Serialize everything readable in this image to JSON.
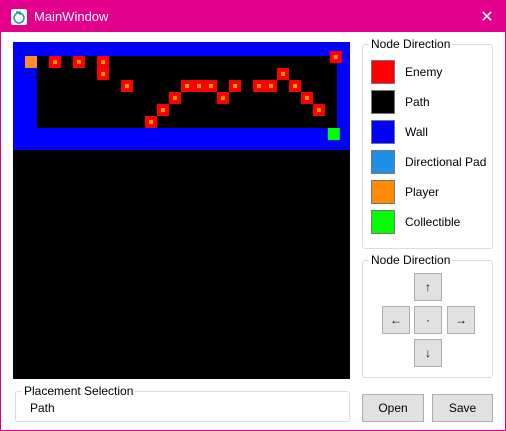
{
  "window": {
    "title": "MainWindow",
    "close_glyph": "✕",
    "accent": "#e3008c"
  },
  "grid": {
    "cols": 14,
    "rows": 14,
    "palette": {
      "wall": "#0000ff",
      "path": "#000000",
      "enemy": "#ff0000",
      "player": "#ff8c28",
      "collectible": "#00ff00",
      "enemy_dot": "#ff9900"
    },
    "cells": {
      "wall": [
        [
          0,
          0
        ],
        [
          1,
          0
        ],
        [
          2,
          0
        ],
        [
          3,
          0
        ],
        [
          4,
          0
        ],
        [
          5,
          0
        ],
        [
          6,
          0
        ],
        [
          7,
          0
        ],
        [
          8,
          0
        ],
        [
          9,
          0
        ],
        [
          10,
          0
        ],
        [
          11,
          0
        ],
        [
          12,
          0
        ],
        [
          13,
          0
        ],
        [
          0,
          1
        ],
        [
          13,
          1
        ],
        [
          0,
          2
        ],
        [
          13,
          2
        ],
        [
          0,
          3
        ],
        [
          13,
          3
        ],
        [
          0,
          4
        ],
        [
          13,
          4
        ],
        [
          0,
          5
        ],
        [
          1,
          5
        ],
        [
          2,
          5
        ],
        [
          3,
          5
        ],
        [
          4,
          5
        ],
        [
          5,
          5
        ],
        [
          6,
          5
        ],
        [
          7,
          5
        ],
        [
          8,
          5
        ],
        [
          9,
          5
        ],
        [
          10,
          5
        ],
        [
          11,
          5
        ],
        [
          12,
          5
        ],
        [
          13,
          5
        ]
      ],
      "player": [
        [
          0,
          0.5
        ]
      ],
      "enemy": [
        [
          1,
          0.5
        ],
        [
          2,
          0.5
        ],
        [
          3,
          0.5
        ],
        [
          3,
          1
        ],
        [
          4,
          1.5
        ],
        [
          5,
          3
        ],
        [
          5.5,
          2.5
        ],
        [
          6,
          2
        ],
        [
          6.5,
          1.5
        ],
        [
          7,
          1.5
        ],
        [
          7.5,
          1.5
        ],
        [
          8,
          2
        ],
        [
          8.5,
          1.5
        ],
        [
          9.5,
          1.5
        ],
        [
          10,
          1.5
        ],
        [
          10.5,
          1
        ],
        [
          11,
          1.5
        ],
        [
          11.5,
          2
        ],
        [
          12,
          2.5
        ],
        [
          12.7,
          0.3
        ]
      ],
      "collectible": [
        [
          12.7,
          3.5
        ]
      ]
    }
  },
  "legend": {
    "title": "Node Direction",
    "items": [
      {
        "label": "Enemy",
        "color": "#ff0000"
      },
      {
        "label": "Path",
        "color": "#000000"
      },
      {
        "label": "Wall",
        "color": "#0000ff"
      },
      {
        "label": "Directional Pad",
        "color": "#1e90e6"
      },
      {
        "label": "Player",
        "color": "#ff8c00"
      },
      {
        "label": "Collectible",
        "color": "#00ff00"
      }
    ]
  },
  "direction_pad": {
    "title": "Node Direction",
    "up": "↑",
    "left": "←",
    "center": "·",
    "right": "→",
    "down": "↓"
  },
  "placement": {
    "title": "Placement Selection",
    "value": "Path"
  },
  "buttons": {
    "open": "Open",
    "save": "Save"
  }
}
